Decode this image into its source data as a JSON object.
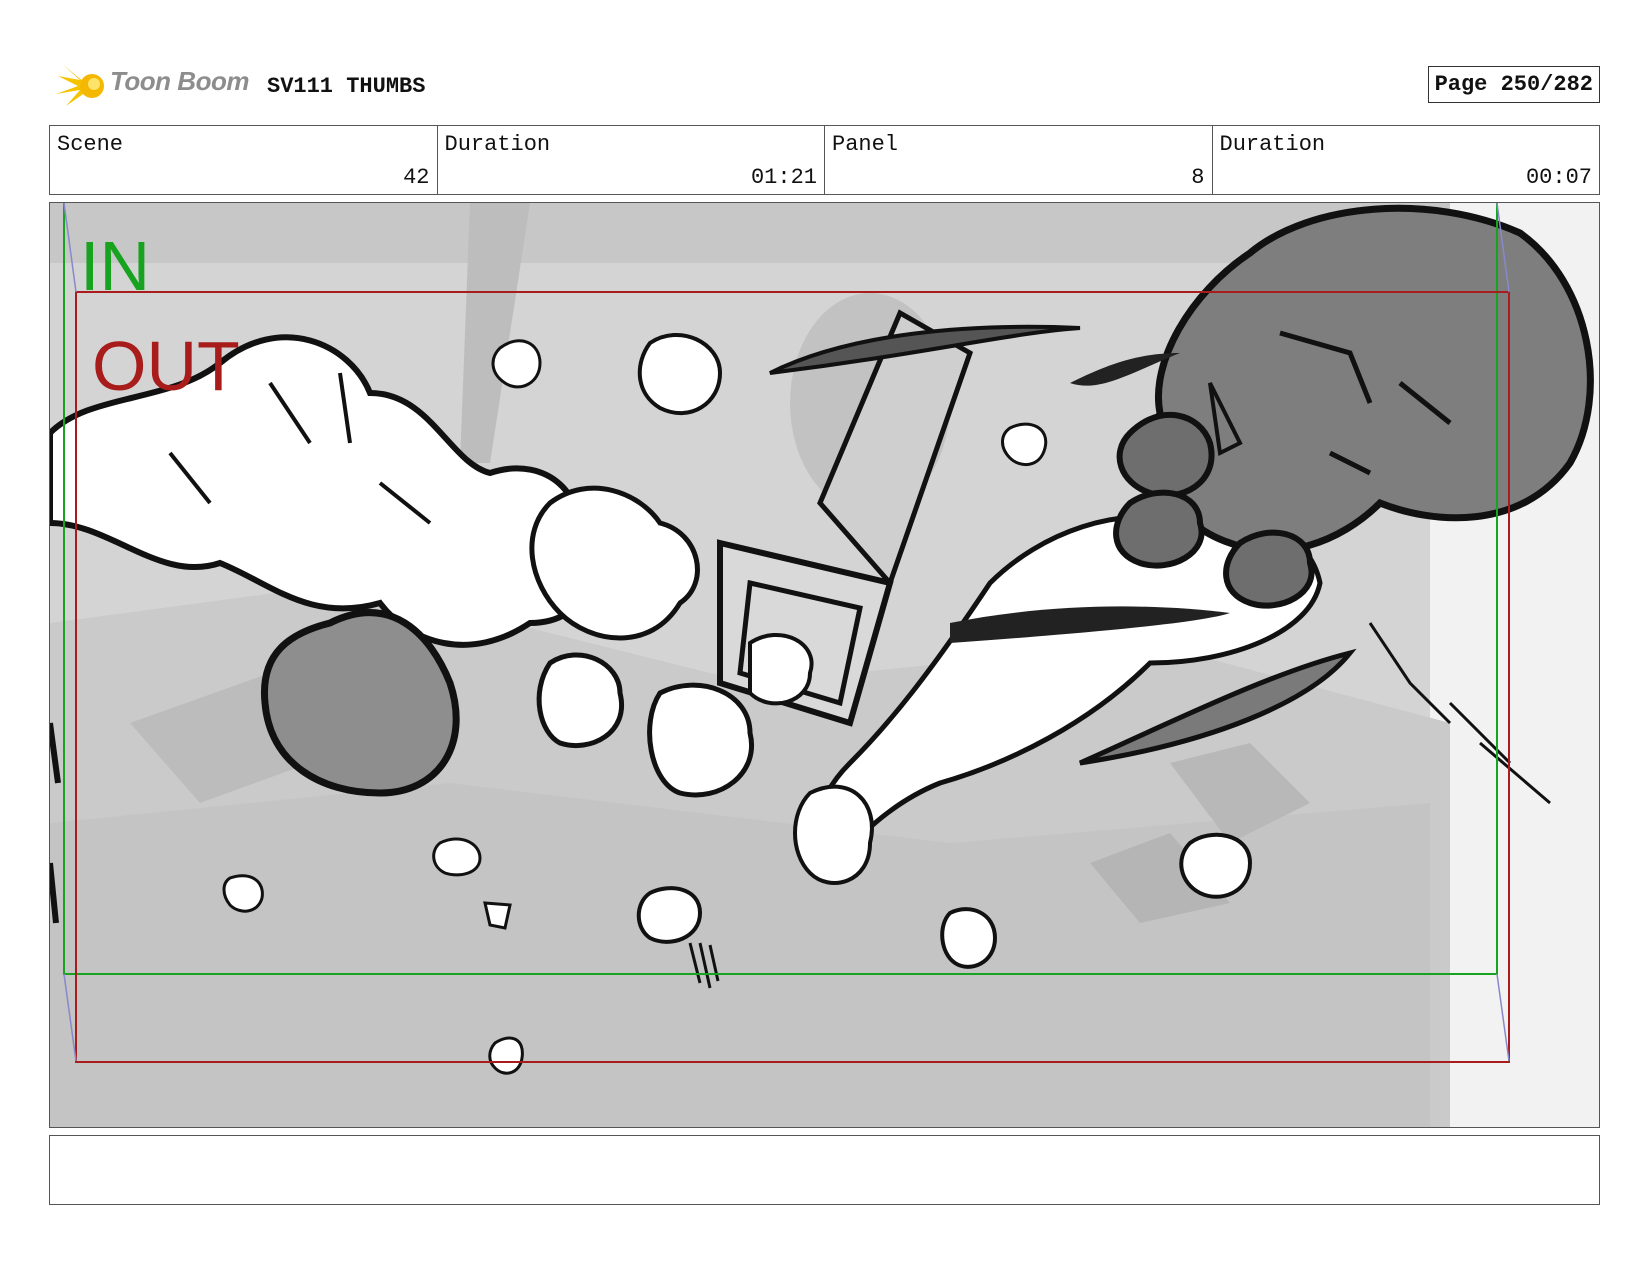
{
  "header": {
    "brand": "Toon Boom",
    "project": "SV111 THUMBS",
    "page": "Page 250/282"
  },
  "info": {
    "scene_label": "Scene",
    "scene_value": "42",
    "duration_label": "Duration",
    "duration_value": "01:21",
    "panel_label": "Panel",
    "panel_value": "8",
    "panel_duration_label": "Duration",
    "panel_duration_value": "00:07"
  },
  "panel": {
    "in_label": "IN",
    "out_label": "OUT"
  },
  "notes": {
    "text": ""
  },
  "colors": {
    "in_frame": "#17a21f",
    "out_frame": "#a81c1c",
    "logo_yellow": "#f5c400"
  }
}
